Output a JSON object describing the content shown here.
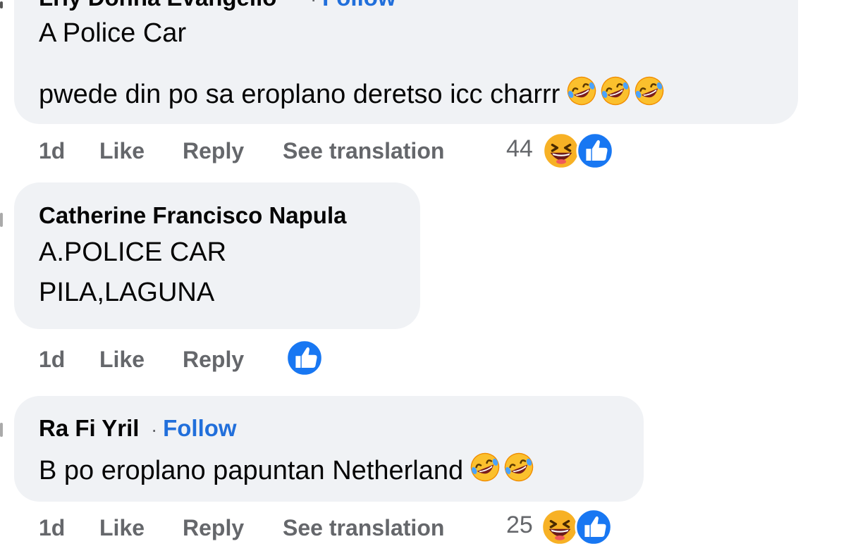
{
  "comments": [
    {
      "author": "Lrly Donna Evangelio",
      "follow": "Follow",
      "lines": [
        "A Police Car",
        "pwede din po sa eroplano deretso icc charrr"
      ],
      "time": "1d",
      "like": "Like",
      "reply": "Reply",
      "translate": "See translation",
      "reaction_count": "44",
      "reaction_icons": [
        "haha-icon",
        "like-icon"
      ],
      "inline_emoji": [
        "rofl-emoji",
        "rofl-emoji",
        "rofl-emoji"
      ]
    },
    {
      "author": "Catherine Francisco Napula",
      "lines": [
        "A.POLICE CAR",
        "PILA,LAGUNA"
      ],
      "time": "1d",
      "like": "Like",
      "reply": "Reply",
      "reaction_icons": [
        "like-icon"
      ]
    },
    {
      "author": "Ra Fi Yril",
      "follow": "Follow",
      "lines": [
        "B po eroplano papuntan Netherland"
      ],
      "time": "1d",
      "like": "Like",
      "reply": "Reply",
      "translate": "See translation",
      "reaction_count": "25",
      "reaction_icons": [
        "haha-icon",
        "like-icon"
      ],
      "inline_emoji": [
        "rofl-emoji",
        "rofl-emoji"
      ]
    }
  ],
  "colors": {
    "bubble_bg": "#f0f2f5",
    "follow_link": "#216fdb",
    "meta_text": "#65676b",
    "like_blue": "#1877f2",
    "haha_yellow": "#f7b125"
  }
}
